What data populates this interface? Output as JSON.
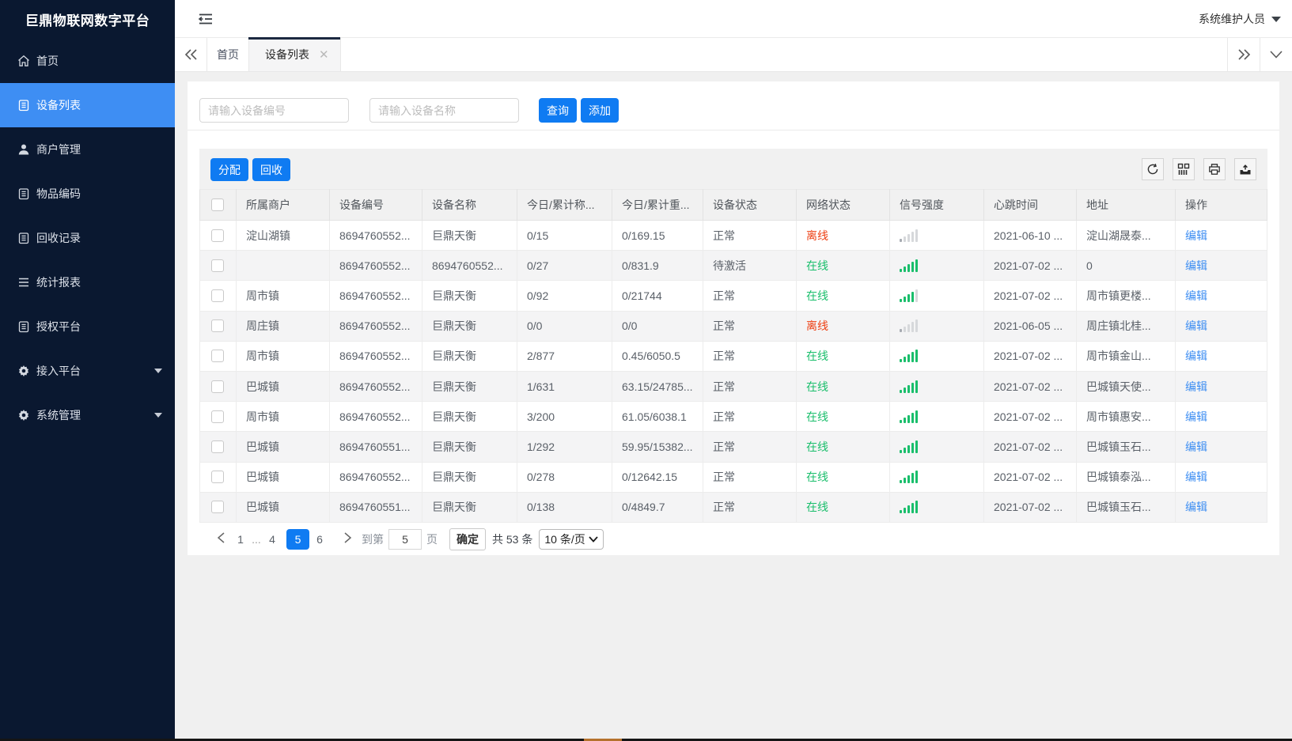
{
  "app": {
    "title": "巨鼎物联网数字平台",
    "user_name": "系统维护人员"
  },
  "colors": {
    "sidebar_bg": "#0a1830",
    "menu_active": "#3e8ef3",
    "primary_button": "#0f7bf2",
    "online_green": "#19be6b",
    "offline_red": "#ed4014",
    "link_blue": "#3e8ef2"
  },
  "sidebar": {
    "items": [
      {
        "label": "首页",
        "icon": "home-icon",
        "active": false,
        "arrow": false
      },
      {
        "label": "设备列表",
        "icon": "device-list-icon",
        "active": true,
        "arrow": false
      },
      {
        "label": "商户管理",
        "icon": "merchant-icon",
        "active": false,
        "arrow": false
      },
      {
        "label": "物品编码",
        "icon": "item-code-icon",
        "active": false,
        "arrow": false
      },
      {
        "label": "回收记录",
        "icon": "recycle-record-icon",
        "active": false,
        "arrow": false
      },
      {
        "label": "统计报表",
        "icon": "report-icon",
        "active": false,
        "arrow": false
      },
      {
        "label": "授权平台",
        "icon": "auth-platform-icon",
        "active": false,
        "arrow": false
      },
      {
        "label": "接入平台",
        "icon": "access-platform-icon",
        "active": false,
        "arrow": true
      },
      {
        "label": "系统管理",
        "icon": "system-manage-icon",
        "active": false,
        "arrow": true
      }
    ]
  },
  "tabs": {
    "items": [
      {
        "label": "首页",
        "active": false,
        "closable": false
      },
      {
        "label": "设备列表",
        "active": true,
        "closable": true
      }
    ]
  },
  "search": {
    "device_no_placeholder": "请输入设备编号",
    "device_name_placeholder": "请输入设备名称",
    "query_label": "查询",
    "add_label": "添加"
  },
  "toolbar": {
    "assign_label": "分配",
    "recycle_label": "回收",
    "icons": [
      "refresh-icon",
      "columns-icon",
      "print-icon",
      "export-icon"
    ]
  },
  "table": {
    "columns": [
      "所属商户",
      "设备编号",
      "设备名称",
      "今日/累计称...",
      "今日/累计重...",
      "设备状态",
      "网络状态",
      "信号强度",
      "心跳时间",
      "地址",
      "操作"
    ],
    "edit_label": "编辑",
    "rows": [
      {
        "merchant": "淀山湖镇",
        "device_no": "8694760552...",
        "device_name": "巨鼎天衡",
        "today_count": "0/15",
        "today_weight": "0/169.15",
        "status": "正常",
        "network": "离线",
        "online": false,
        "signal": 1,
        "heartbeat": "2021-06-10 ...",
        "address": "淀山湖晟泰..."
      },
      {
        "merchant": "",
        "device_no": "8694760552...",
        "device_name": "8694760552...",
        "today_count": "0/27",
        "today_weight": "0/831.9",
        "status": "待激活",
        "network": "在线",
        "online": true,
        "signal": 5,
        "heartbeat": "2021-07-02 ...",
        "address": "0"
      },
      {
        "merchant": "周市镇",
        "device_no": "8694760552...",
        "device_name": "巨鼎天衡",
        "today_count": "0/92",
        "today_weight": "0/21744",
        "status": "正常",
        "network": "在线",
        "online": true,
        "signal": 4,
        "heartbeat": "2021-07-02 ...",
        "address": "周市镇更楼..."
      },
      {
        "merchant": "周庄镇",
        "device_no": "8694760552...",
        "device_name": "巨鼎天衡",
        "today_count": "0/0",
        "today_weight": "0/0",
        "status": "正常",
        "network": "离线",
        "online": false,
        "signal": 1,
        "heartbeat": "2021-06-05 ...",
        "address": "周庄镇北桂..."
      },
      {
        "merchant": "周市镇",
        "device_no": "8694760552...",
        "device_name": "巨鼎天衡",
        "today_count": "2/877",
        "today_weight": "0.45/6050.5",
        "status": "正常",
        "network": "在线",
        "online": true,
        "signal": 5,
        "heartbeat": "2021-07-02 ...",
        "address": "周市镇金山..."
      },
      {
        "merchant": "巴城镇",
        "device_no": "8694760552...",
        "device_name": "巨鼎天衡",
        "today_count": "1/631",
        "today_weight": "63.15/24785...",
        "status": "正常",
        "network": "在线",
        "online": true,
        "signal": 5,
        "heartbeat": "2021-07-02 ...",
        "address": "巴城镇天使..."
      },
      {
        "merchant": "周市镇",
        "device_no": "8694760552...",
        "device_name": "巨鼎天衡",
        "today_count": "3/200",
        "today_weight": "61.05/6038.1",
        "status": "正常",
        "network": "在线",
        "online": true,
        "signal": 5,
        "heartbeat": "2021-07-02 ...",
        "address": "周市镇惠安..."
      },
      {
        "merchant": "巴城镇",
        "device_no": "8694760551...",
        "device_name": "巨鼎天衡",
        "today_count": "1/292",
        "today_weight": "59.95/15382...",
        "status": "正常",
        "network": "在线",
        "online": true,
        "signal": 5,
        "heartbeat": "2021-07-02 ...",
        "address": "巴城镇玉石..."
      },
      {
        "merchant": "巴城镇",
        "device_no": "8694760552...",
        "device_name": "巨鼎天衡",
        "today_count": "0/278",
        "today_weight": "0/12642.15",
        "status": "正常",
        "network": "在线",
        "online": true,
        "signal": 5,
        "heartbeat": "2021-07-02 ...",
        "address": "巴城镇泰泓..."
      },
      {
        "merchant": "巴城镇",
        "device_no": "8694760551...",
        "device_name": "巨鼎天衡",
        "today_count": "0/138",
        "today_weight": "0/4849.7",
        "status": "正常",
        "network": "在线",
        "online": true,
        "signal": 5,
        "heartbeat": "2021-07-02 ...",
        "address": "巴城镇玉石..."
      }
    ]
  },
  "pagination": {
    "pages": [
      "1",
      "...",
      "4",
      "5",
      "6"
    ],
    "current": "5",
    "goto_label": "到第",
    "goto_value": "5",
    "page_unit_label": "页",
    "confirm_label": "确定",
    "total_label": "共 53 条",
    "page_size_label": "10 条/页"
  }
}
